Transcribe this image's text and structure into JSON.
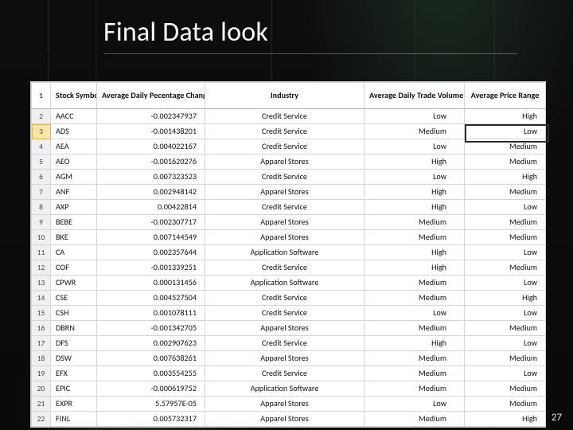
{
  "title": "Final Data look",
  "page_number": "27",
  "columns": {
    "sym": "Stock Symbol",
    "pct": "Average Daily Pecentage Change",
    "ind": "Industry",
    "vol": "Average Daily Trade Volume",
    "rng": "Average Price Range"
  },
  "selected_row_index": 1,
  "row_numbers": [
    "1",
    "2",
    "3",
    "4",
    "5",
    "6",
    "7",
    "8",
    "9",
    "10",
    "11",
    "12",
    "13",
    "14",
    "15",
    "16",
    "17",
    "18",
    "19",
    "20",
    "21",
    "22"
  ],
  "rows": [
    {
      "sym": "AACC",
      "pct": "-0.002347937",
      "ind": "Credit Service",
      "vol": "Low",
      "rng": "High"
    },
    {
      "sym": "ADS",
      "pct": "-0.001438201",
      "ind": "Credit Service",
      "vol": "Medium",
      "rng": "Low"
    },
    {
      "sym": "AEA",
      "pct": "0.004022167",
      "ind": "Credit Service",
      "vol": "Low",
      "rng": "Medium"
    },
    {
      "sym": "AEO",
      "pct": "-0.001620276",
      "ind": "Apparel Stores",
      "vol": "High",
      "rng": "Medium"
    },
    {
      "sym": "AGM",
      "pct": "0.007323523",
      "ind": "Credit Service",
      "vol": "Low",
      "rng": "High"
    },
    {
      "sym": "ANF",
      "pct": "0.002948142",
      "ind": "Apparel Stores",
      "vol": "High",
      "rng": "Medium"
    },
    {
      "sym": "AXP",
      "pct": "0.00422814",
      "ind": "Credit Service",
      "vol": "High",
      "rng": "Low"
    },
    {
      "sym": "BEBE",
      "pct": "-0.002307717",
      "ind": "Apparel Stores",
      "vol": "Medium",
      "rng": "Medium"
    },
    {
      "sym": "BKE",
      "pct": "0.007144549",
      "ind": "Apparel Stores",
      "vol": "Medium",
      "rng": "Medium"
    },
    {
      "sym": "CA",
      "pct": "0.002357644",
      "ind": "Application Software",
      "vol": "High",
      "rng": "Low"
    },
    {
      "sym": "COF",
      "pct": "-0.001339251",
      "ind": "Credit Service",
      "vol": "High",
      "rng": "Medium"
    },
    {
      "sym": "CPWR",
      "pct": "0.000131456",
      "ind": "Application Software",
      "vol": "Medium",
      "rng": "Low"
    },
    {
      "sym": "CSE",
      "pct": "0.004527504",
      "ind": "Credit Service",
      "vol": "Medium",
      "rng": "High"
    },
    {
      "sym": "CSH",
      "pct": "0.001078111",
      "ind": "Credit Service",
      "vol": "Low",
      "rng": "Low"
    },
    {
      "sym": "DBRN",
      "pct": "-0.001342705",
      "ind": "Apparel Stores",
      "vol": "Medium",
      "rng": "Medium"
    },
    {
      "sym": "DFS",
      "pct": "0.002907623",
      "ind": "Credit Service",
      "vol": "High",
      "rng": "Low"
    },
    {
      "sym": "DSW",
      "pct": "0.007638261",
      "ind": "Apparel Stores",
      "vol": "Medium",
      "rng": "Medium"
    },
    {
      "sym": "EFX",
      "pct": "0.003554255",
      "ind": "Credit Service",
      "vol": "Medium",
      "rng": "Low"
    },
    {
      "sym": "EPIC",
      "pct": "-0.000619752",
      "ind": "Application Software",
      "vol": "Medium",
      "rng": "Medium"
    },
    {
      "sym": "EXPR",
      "pct": "5.57957E-05",
      "ind": "Apparel Stores",
      "vol": "Low",
      "rng": "Medium"
    },
    {
      "sym": "FINL",
      "pct": "0.005732317",
      "ind": "Apparel Stores",
      "vol": "Medium",
      "rng": "High"
    }
  ]
}
